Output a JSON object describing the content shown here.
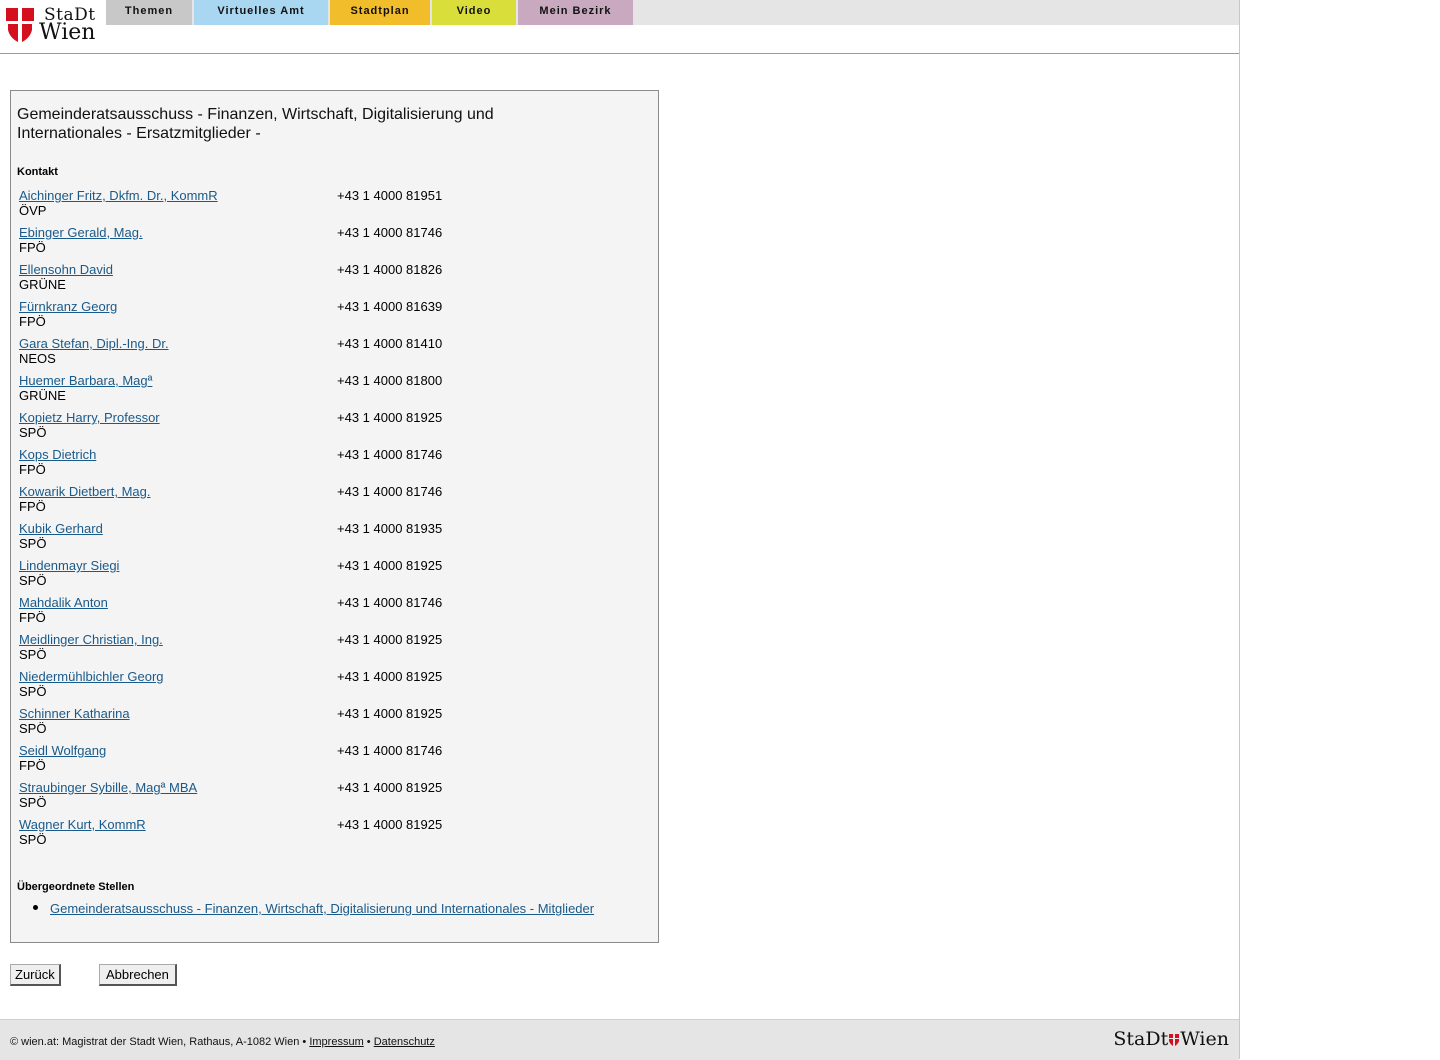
{
  "header": {
    "logo_line1": "StaDt",
    "logo_line2": "Wien",
    "tabs": [
      {
        "label": "Themen",
        "color": "#c8c8c8"
      },
      {
        "label": "Virtuelles Amt",
        "color": "#a9d6f0"
      },
      {
        "label": "Stadtplan",
        "color": "#f2bd2a"
      },
      {
        "label": "Video",
        "color": "#d9de3a"
      },
      {
        "label": "Mein Bezirk",
        "color": "#c9a9c0"
      }
    ]
  },
  "main": {
    "title": "Gemeinderatsausschuss - Finanzen, Wirtschaft, Digitalisierung und Internationales - Ersatzmitglieder -",
    "contact_heading": "Kontakt",
    "members": [
      {
        "name": "Aichinger Fritz, Dkfm. Dr., KommR",
        "party": "ÖVP",
        "phone": "+43 1 4000 81951"
      },
      {
        "name": "Ebinger Gerald, Mag.",
        "party": "FPÖ",
        "phone": "+43 1 4000 81746"
      },
      {
        "name": "Ellensohn David",
        "party": "GRÜNE",
        "phone": "+43 1 4000 81826"
      },
      {
        "name": "Fürnkranz Georg",
        "party": "FPÖ",
        "phone": "+43 1 4000 81639"
      },
      {
        "name": "Gara Stefan, Dipl.-Ing. Dr.",
        "party": "NEOS",
        "phone": "+43 1 4000 81410"
      },
      {
        "name": "Huemer Barbara, Magª",
        "party": "GRÜNE",
        "phone": "+43 1 4000 81800"
      },
      {
        "name": "Kopietz Harry, Professor",
        "party": "SPÖ",
        "phone": "+43 1 4000 81925"
      },
      {
        "name": "Kops Dietrich",
        "party": "FPÖ",
        "phone": "+43 1 4000 81746"
      },
      {
        "name": "Kowarik Dietbert, Mag.",
        "party": "FPÖ",
        "phone": "+43 1 4000 81746"
      },
      {
        "name": "Kubik Gerhard",
        "party": "SPÖ",
        "phone": "+43 1 4000 81935"
      },
      {
        "name": "Lindenmayr Siegi",
        "party": "SPÖ",
        "phone": "+43 1 4000 81925"
      },
      {
        "name": "Mahdalik Anton",
        "party": "FPÖ",
        "phone": "+43 1 4000 81746"
      },
      {
        "name": "Meidlinger Christian, Ing.",
        "party": "SPÖ",
        "phone": "+43 1 4000 81925"
      },
      {
        "name": "Niedermühlbichler Georg",
        "party": "SPÖ",
        "phone": "+43 1 4000 81925"
      },
      {
        "name": "Schinner Katharina",
        "party": "SPÖ",
        "phone": "+43 1 4000 81925"
      },
      {
        "name": "Seidl Wolfgang",
        "party": "FPÖ",
        "phone": "+43 1 4000 81746"
      },
      {
        "name": "Straubinger Sybille, Magª MBA",
        "party": "SPÖ",
        "phone": "+43 1 4000 81925"
      },
      {
        "name": "Wagner Kurt, KommR",
        "party": "SPÖ",
        "phone": "+43 1 4000 81925"
      }
    ],
    "parent_heading": "Übergeordnete Stellen",
    "parent_link": "Gemeinderatsausschuss - Finanzen, Wirtschaft, Digitalisierung und Internationales - Mitglieder"
  },
  "buttons": {
    "back": "Zurück",
    "cancel": "Abbrechen"
  },
  "footer": {
    "copyright": "© wien.at: Magistrat der Stadt Wien, Rathaus, A-1082 Wien •",
    "sep": "•",
    "impressum": "Impressum",
    "datenschutz": "Datenschutz",
    "logo_left": "StaDt",
    "logo_right": "Wien"
  }
}
